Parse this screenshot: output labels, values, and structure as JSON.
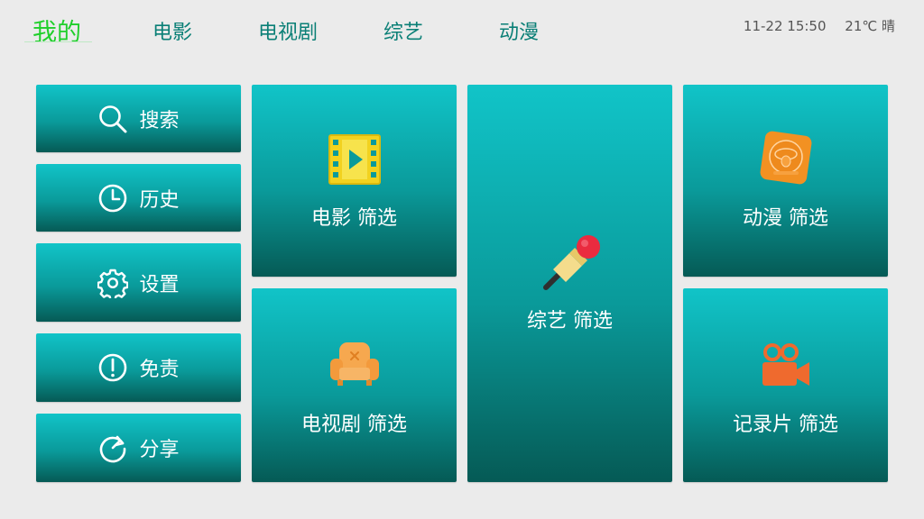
{
  "nav": {
    "tabs": [
      {
        "label": "我的",
        "active": true
      },
      {
        "label": "电影"
      },
      {
        "label": "电视剧"
      },
      {
        "label": "综艺"
      },
      {
        "label": "动漫"
      }
    ],
    "status": {
      "datetime": "11-22 15:50",
      "weather": "21℃ 晴"
    }
  },
  "sidebar": {
    "items": [
      {
        "label": "搜索",
        "icon": "search-icon"
      },
      {
        "label": "历史",
        "icon": "clock-icon"
      },
      {
        "label": "设置",
        "icon": "gear-icon"
      },
      {
        "label": "免责",
        "icon": "exclamation-icon"
      },
      {
        "label": "分享",
        "icon": "share-icon"
      }
    ]
  },
  "tiles": {
    "movie": {
      "label": "电影 筛选",
      "icon": "film-icon"
    },
    "tv": {
      "label": "电视剧 筛选",
      "icon": "sofa-icon"
    },
    "variety": {
      "label": "综艺 筛选",
      "icon": "microphone-icon"
    },
    "anime": {
      "label": "动漫 筛选",
      "icon": "anime-badge-icon"
    },
    "documentary": {
      "label": "记录片 筛选",
      "icon": "video-camera-icon"
    }
  },
  "colors": {
    "active_tab": "#1fcf2a",
    "tab": "#0a7f76",
    "tile_top": "#11c4c8",
    "tile_bottom": "#055a55",
    "background": "#ebebeb"
  }
}
